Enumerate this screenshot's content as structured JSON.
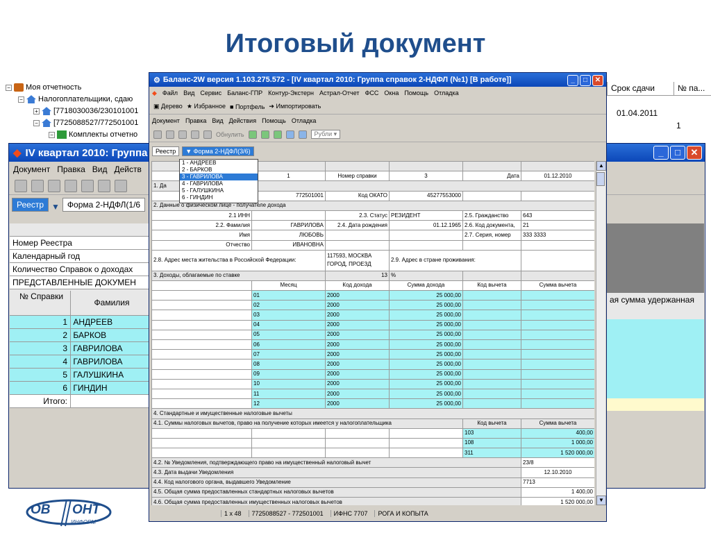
{
  "slide_title": "Итоговый документ",
  "tree": [
    {
      "label": "Моя отчетность",
      "toggle": "−"
    },
    {
      "label": "Налогоплательщики, сдаю",
      "toggle": "−"
    },
    {
      "label": "[7718030036/230101001",
      "toggle": "+"
    },
    {
      "label": "[7725088527/772501001",
      "toggle": "−"
    },
    {
      "label": "Комплекты отчетно",
      "toggle": "−"
    }
  ],
  "right_strip": {
    "columns": [
      "Срок сдачи",
      "№ па..."
    ],
    "due_date": "01.04.2011",
    "number": "1"
  },
  "back_window": {
    "title": "IV квартал 2010: Группа",
    "menu": [
      "Документ",
      "Правка",
      "Вид",
      "Действ"
    ],
    "tabs": [
      "Реестр",
      "Форма 2-НДФЛ(1/6"
    ],
    "rows": [
      "Номер Реестра",
      "Календарный год",
      "Количество Справок о доходах",
      "ПРЕДСТАВЛЕННЫЕ ДОКУМЕН"
    ],
    "col_num": "№ Справки",
    "col_name": "Фамилия",
    "right_header": "ая сумма удержанная",
    "people": [
      {
        "n": "1",
        "name": "АНДРЕЕВ"
      },
      {
        "n": "2",
        "name": "БАРКОВ"
      },
      {
        "n": "3",
        "name": "ГАВРИЛОВА"
      },
      {
        "n": "4",
        "name": "ГАВРИЛОВА"
      },
      {
        "n": "5",
        "name": "ГАЛУШКИНА"
      },
      {
        "n": "6",
        "name": "ГИНДИН"
      }
    ],
    "total": "Итого:"
  },
  "main_window": {
    "title": "Баланс-2W  версия 1.103.275.572 - [IV квартал 2010: Группа справок 2-НДФЛ (№1) [В работе]]",
    "menu1": [
      "Файл",
      "Вид",
      "Сервис",
      "Баланс-ГПР",
      "Контур-Экстерн",
      "Астрал-Отчет",
      "ФСС",
      "Окна",
      "Помощь",
      "Отладка"
    ],
    "toolbar1": [
      "Дерево",
      "Избранное",
      "Портфель",
      "Импортировать"
    ],
    "menu2": [
      "Документ",
      "Правка",
      "Вид",
      "Действия",
      "Помощь",
      "Отладка"
    ],
    "toolbar2_obnulit": "Обнулить",
    "toolbar2_rubli": "Рубли",
    "tab_registry": "Реестр",
    "tab_form": "Форма 2-НДФЛ(3/6)",
    "dropdown": [
      "1 - АНДРЕЕВ",
      "2 - БАРКОВ",
      "3 - ГАВРИЛОВА",
      "4 - ГАВРИЛОВА",
      "5 - ГАЛУШКИНА",
      "6 - ГИНДИН"
    ],
    "status": [
      "1 x 48",
      "7725088527 - 772501001",
      "ИФНС 7707",
      "РОГА И КОПЫТА"
    ]
  },
  "form": {
    "spravka_no_label": "Номер справки",
    "spravka_no": "3",
    "date_label": "Дата",
    "date": "01.12.2010",
    "year_val": "1",
    "s1": "1. Да",
    "kpp": "772501001",
    "okato_label": "Код ОКАТО",
    "okato": "45277553000",
    "s2": "2. Данные о физическом лице - получателе дохода",
    "inn_label": "2.1 ИНН",
    "status_label": "2.3. Статус",
    "status": "РЕЗИДЕНТ",
    "citizenship_label": "2.5. Гражданство",
    "citizenship": "643",
    "surname_label": "2.2. Фамилия",
    "surname": "ГАВРИЛОВА",
    "dob_label": "2.4. Дата рождения",
    "dob": "01.12.1965",
    "doccode_label": "2.6. Код документа,",
    "doccode": "21",
    "name_label": "Имя",
    "name": "ЛЮБОВЬ",
    "series_label": "2.7. Серия, номер",
    "series": "333 3333",
    "patronymic_label": "Отчество",
    "patronymic": "ИВАНОВНА",
    "addr_label": "2.8. Адрес места жительства в Российской Федерации:",
    "addr": "117593, МОСКВА ГОРОД, ПРОЕЗД",
    "addr_abroad_label": "2.9. Адрес в стране проживания:",
    "s3": "3. Доходы, облагаемые по ставке",
    "rate": "13",
    "pct": "%",
    "income_cols": [
      "Месяц",
      "Код дохода",
      "Сумма дохода",
      "Код вычета",
      "Сумма вычета"
    ],
    "income": [
      {
        "m": "01",
        "code": "2000",
        "sum": "25 000,00"
      },
      {
        "m": "02",
        "code": "2000",
        "sum": "25 000,00"
      },
      {
        "m": "03",
        "code": "2000",
        "sum": "25 000,00"
      },
      {
        "m": "04",
        "code": "2000",
        "sum": "25 000,00"
      },
      {
        "m": "05",
        "code": "2000",
        "sum": "25 000,00"
      },
      {
        "m": "06",
        "code": "2000",
        "sum": "25 000,00"
      },
      {
        "m": "07",
        "code": "2000",
        "sum": "25 000,00"
      },
      {
        "m": "08",
        "code": "2000",
        "sum": "25 000,00"
      },
      {
        "m": "09",
        "code": "2000",
        "sum": "25 000,00"
      },
      {
        "m": "10",
        "code": "2000",
        "sum": "25 000,00"
      },
      {
        "m": "11",
        "code": "2000",
        "sum": "25 000,00"
      },
      {
        "m": "12",
        "code": "2000",
        "sum": "25 000,00"
      }
    ],
    "s4": "4. Стандартные и имущественные налоговые вычеты",
    "s41": "4.1. Суммы налоговых вычетов, право на получение которых имеется у налогоплательщика",
    "ded_code_col": "Код вычета",
    "ded_sum_col": "Сумма вычета",
    "deductions": [
      {
        "code": "103",
        "sum": "400,00"
      },
      {
        "code": "108",
        "sum": "1 000,00"
      },
      {
        "code": "311",
        "sum": "1 520 000,00"
      }
    ],
    "s42": "4.2. № Уведомления, подтверждающего право на имущественный налоговый вычет",
    "s42v": "23/8",
    "s43": "4.3. Дата выдачи Уведомления",
    "s43v": "12.10.2010",
    "s44": "4.4. Код налогового органа, выдавшего Уведомление",
    "s44v": "7713",
    "s45": "4.5. Общая сумма предоставленных стандартных налоговых вычетов",
    "s45v": "1 400,00",
    "s46": "4.6. Общая сумма предоставленных имущественных налоговых вычетов",
    "s46v": "1 520 000,00"
  },
  "logo": {
    "left": "ОВ",
    "right": "ОНТ",
    "sub": "ИНФОРМ"
  }
}
